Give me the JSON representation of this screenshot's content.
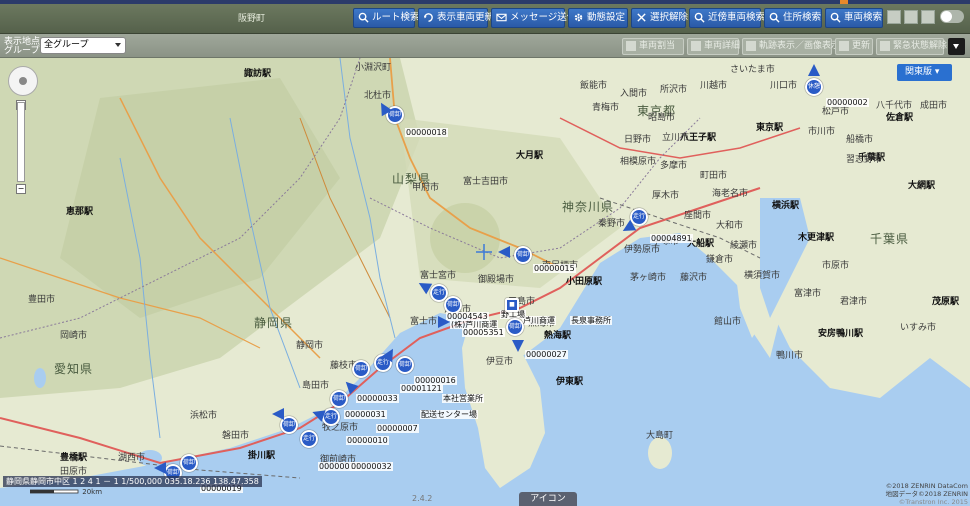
{
  "toolbar": {
    "top_left_label": "阪野町",
    "buttons": {
      "route": "ルート検索",
      "refresh": "表示車両更新",
      "message": "メッセージ送信",
      "settings": "動態設定",
      "select_clear": "選択解除",
      "nearby": "近傍車両検索",
      "address": "住所検索",
      "vehicle": "車両検索"
    }
  },
  "subbar": {
    "group_label_1": "表示地点",
    "group_label_2": "グループ",
    "group_value": "全グループ",
    "buttons": {
      "b1": "車両割当",
      "b2": "車両詳細",
      "b3": "軌跡表示／画像表示",
      "b4": "更新",
      "b5": "緊急状態解除"
    }
  },
  "map": {
    "dropdown_label": "関東版",
    "prefectures": [
      "山梨県",
      "神奈川県",
      "静岡県",
      "愛知県",
      "千葉県",
      "東京都"
    ],
    "stations": [
      "恵那駅",
      "大月駅",
      "横浜駅",
      "木更津駅",
      "千葉駅",
      "大網駅",
      "小田原駅",
      "熱海駅",
      "伊東駅",
      "掛川駅",
      "豊橋駅",
      "大船駅",
      "安房鴨川駅",
      "佐倉駅",
      "東京駅",
      "茂原駅",
      "八王子駅",
      "諏訪駅"
    ],
    "cities": [
      "小淵沢町",
      "北杜市",
      "甲府市",
      "富士吉田市",
      "富士宮市",
      "沼津市",
      "三島市",
      "伊豆市",
      "熱海市",
      "南足柄市",
      "相模原市",
      "厚木市",
      "平塚市",
      "浜松市",
      "磐田市",
      "豊田市",
      "岡崎市",
      "田原市",
      "湖西市",
      "御前崎市",
      "牧之原市",
      "島田市",
      "藤枝市",
      "富士市",
      "静岡市",
      "御殿場市",
      "大島町",
      "館山市",
      "鴨川市",
      "いすみ市",
      "市原市",
      "君津市",
      "富津市",
      "横須賀市",
      "鎌倉市",
      "藤沢市",
      "茅ヶ崎市",
      "秦野市",
      "伊勢原市",
      "座間市",
      "海老名市",
      "大和市",
      "綾瀬市",
      "町田市",
      "多摩市",
      "日野市",
      "立川市",
      "昭島市",
      "青梅市",
      "飯能市",
      "入間市",
      "所沢市",
      "川越市",
      "さいたま市",
      "川口市",
      "松戸市",
      "市川市",
      "船橋市",
      "習志野市",
      "八千代市",
      "成田市"
    ],
    "vehicle_ids": [
      "00000018",
      "00000002",
      "00004891",
      "00000015",
      "00000027",
      "00004543",
      "00005351",
      "00000016",
      "00001121",
      "00000033",
      "00000031",
      "00000010",
      "00000013",
      "00000032",
      "00000019",
      "00000007"
    ],
    "annotations": [
      "(株)芦川商運",
      "芦川商運",
      "長泉事務所",
      "本社営業所",
      "配送センター場",
      "野工場"
    ],
    "coordinate_readout": "静岡県静岡市中区 1 2 4 1 － 1  1/500,000 035.18.236 138.47.358",
    "scale": "20km",
    "version": "2.4.2",
    "tab": "アイコン",
    "copyright_1": "©2018 ZENRIN DataCom",
    "copyright_2": "地図データ©2018 ZENRIN",
    "copyright_3": "©Transtron Inc. 2015"
  },
  "colors": {
    "vehicle_marker": "#2a5bc6",
    "toolbar_button": "#2f66b8",
    "sea": "#a9cdf0",
    "land": "#e6ead2"
  }
}
